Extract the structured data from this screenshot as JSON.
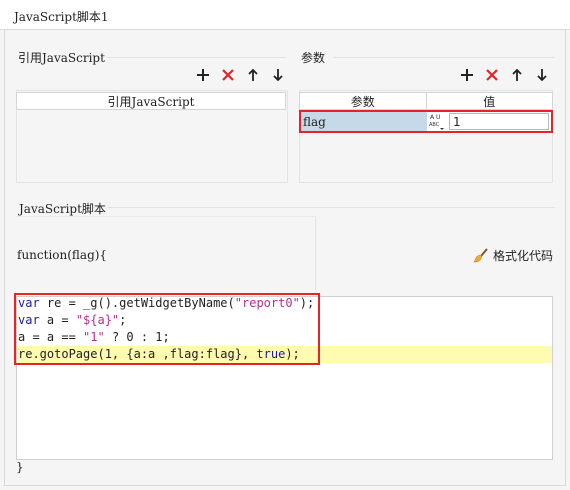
{
  "window": {
    "title": "JavaScript脚本1"
  },
  "references": {
    "section_title": "引用JavaScript",
    "column_header": "引用JavaScript",
    "toolbar": [
      "add-icon",
      "delete-icon",
      "move-up-icon",
      "move-down-icon"
    ]
  },
  "params": {
    "section_title": "参数",
    "columns": [
      "参数",
      "值"
    ],
    "rows": [
      {
        "name": "flag",
        "type_icon": "abc-type-icon",
        "value": "1"
      }
    ],
    "toolbar": [
      "add-icon",
      "delete-icon",
      "move-up-icon",
      "move-down-icon"
    ]
  },
  "script": {
    "section_title": "JavaScript脚本",
    "function_header": "function(flag){",
    "format_button": "格式化代码",
    "lines": [
      "var re = _g().getWidgetByName(\"report0\");",
      "var a = \"${a}\";",
      "a = a == \"1\" ? 0 : 1;",
      "re.gotoPage(1, {a:a ,flag:flag}, true);"
    ],
    "closing": "}"
  },
  "colors": {
    "highlight_box": "#e4232b",
    "selected_cell": "#c6d9e8",
    "current_line": "#fffbb0",
    "keyword": "#1a1aa6",
    "string": "#b42f8f"
  }
}
